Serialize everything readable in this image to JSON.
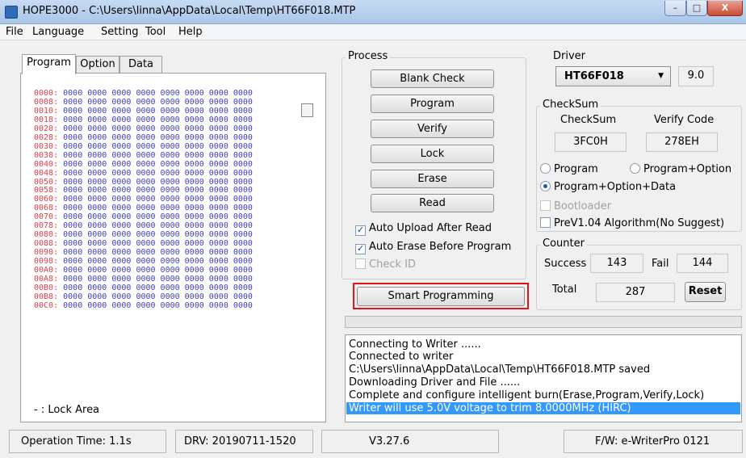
{
  "window": {
    "title": "HOPE3000 - C:\\Users\\linna\\AppData\\Local\\Temp\\HT66F018.MTP",
    "minimize": "–",
    "maximize": "□",
    "close": "X"
  },
  "menu": [
    "File",
    "Language",
    "Setting",
    "Tool",
    "Help"
  ],
  "tabs": [
    "Program",
    "Option",
    "Data"
  ],
  "hex_rows": [
    {
      "addr": "0000:",
      "values": "0000 0000 0000 0000 0000 0000 0000 0000"
    },
    {
      "addr": "0008:",
      "values": "0000 0000 0000 0000 0000 0000 0000 0000"
    },
    {
      "addr": "0010:",
      "values": "0000 0000 0000 0000 0000 0000 0000 0000"
    },
    {
      "addr": "0018:",
      "values": "0000 0000 0000 0000 0000 0000 0000 0000"
    },
    {
      "addr": "0020:",
      "values": "0000 0000 0000 0000 0000 0000 0000 0000"
    },
    {
      "addr": "0028:",
      "values": "0000 0000 0000 0000 0000 0000 0000 0000"
    },
    {
      "addr": "0030:",
      "values": "0000 0000 0000 0000 0000 0000 0000 0000"
    },
    {
      "addr": "0038:",
      "values": "0000 0000 0000 0000 0000 0000 0000 0000"
    },
    {
      "addr": "0040:",
      "values": "0000 0000 0000 0000 0000 0000 0000 0000"
    },
    {
      "addr": "0048:",
      "values": "0000 0000 0000 0000 0000 0000 0000 0000"
    },
    {
      "addr": "0050:",
      "values": "0000 0000 0000 0000 0000 0000 0000 0000"
    },
    {
      "addr": "0058:",
      "values": "0000 0000 0000 0000 0000 0000 0000 0000"
    },
    {
      "addr": "0060:",
      "values": "0000 0000 0000 0000 0000 0000 0000 0000"
    },
    {
      "addr": "0068:",
      "values": "0000 0000 0000 0000 0000 0000 0000 0000"
    },
    {
      "addr": "0070:",
      "values": "0000 0000 0000 0000 0000 0000 0000 0000"
    },
    {
      "addr": "0078:",
      "values": "0000 0000 0000 0000 0000 0000 0000 0000"
    },
    {
      "addr": "0080:",
      "values": "0000 0000 0000 0000 0000 0000 0000 0000"
    },
    {
      "addr": "0088:",
      "values": "0000 0000 0000 0000 0000 0000 0000 0000"
    },
    {
      "addr": "0090:",
      "values": "0000 0000 0000 0000 0000 0000 0000 0000"
    },
    {
      "addr": "0098:",
      "values": "0000 0000 0000 0000 0000 0000 0000 0000"
    },
    {
      "addr": "00A0:",
      "values": "0000 0000 0000 0000 0000 0000 0000 0000"
    },
    {
      "addr": "00A8:",
      "values": "0000 0000 0000 0000 0000 0000 0000 0000"
    },
    {
      "addr": "00B0:",
      "values": "0000 0000 0000 0000 0000 0000 0000 0000"
    },
    {
      "addr": "00B8:",
      "values": "0000 0000 0000 0000 0000 0000 0000 0000"
    },
    {
      "addr": "00C0:",
      "values": "0000 0000 0000 0000 0000 0000 0000 0000"
    }
  ],
  "lock_area_label": "- : Lock Area",
  "process": {
    "label": "Process",
    "buttons": [
      "Blank Check",
      "Program",
      "Verify",
      "Lock",
      "Erase",
      "Read"
    ],
    "auto_upload": {
      "label": "Auto Upload After Read",
      "checked": true
    },
    "auto_erase": {
      "label": "Auto Erase Before Program",
      "checked": true
    },
    "check_id": {
      "label": "Check ID",
      "checked": false,
      "enabled": false
    },
    "smart_programming": "Smart Programming"
  },
  "driver": {
    "label": "Driver",
    "selected": "HT66F018",
    "version": "9.0"
  },
  "checksum": {
    "label": "CheckSum",
    "col_checksum": "CheckSum",
    "col_verify": "Verify Code",
    "checksum_value": "3FC0H",
    "verify_value": "278EH",
    "radio_program": "Program",
    "radio_program_option": "Program+Option",
    "radio_program_option_data": "Program+Option+Data",
    "selected": "Program+Option+Data",
    "bootloader": "Bootloader",
    "prev_algorithm": "PreV1.04 Algorithm(No Suggest)"
  },
  "counter": {
    "label": "Counter",
    "success_label": "Success",
    "success_value": "143",
    "fail_label": "Fail",
    "fail_value": "144",
    "total_label": "Total",
    "total_value": "287",
    "reset": "Reset"
  },
  "log": [
    "Connecting to Writer ......",
    "Connected to writer",
    "C:\\Users\\linna\\AppData\\Local\\Temp\\HT66F018.MTP saved",
    "Downloading Driver and File ......",
    "Complete and configure intelligent burn(Erase,Program,Verify,Lock)",
    "Writer will use 5.0V voltage to trim 8.0000MHz (HIRC)"
  ],
  "statusbar": {
    "operation_time": "Operation Time: 1.1s",
    "drv": "DRV: 20190711-1520",
    "version": "V3.27.6",
    "firmware": "F/W: e-WriterPro 0121"
  },
  "colors": {
    "hex_address": "#e0404a",
    "hex_value": "#3d3dd0",
    "log_selection": "#3399ff",
    "highlight_box": "#e2131b"
  }
}
